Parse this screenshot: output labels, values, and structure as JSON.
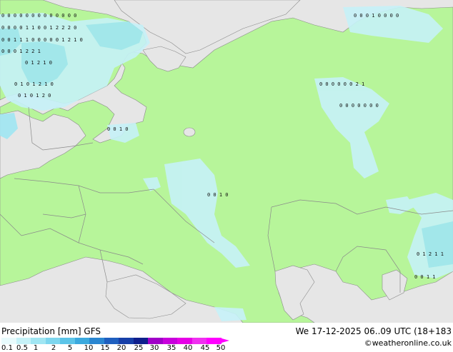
{
  "title": "Precipitation [mm]",
  "model": "GFS",
  "valid": "We 17-12-2025 06..09 UTC (18+183",
  "credit": "©weatheronline.co.uk",
  "legend": {
    "ticks": [
      "0.1",
      "0.5",
      "1",
      "2",
      "5",
      "10",
      "15",
      "20",
      "25",
      "30",
      "35",
      "40",
      "45",
      "50"
    ],
    "colors": [
      "#e8fbfd",
      "#c6f2f8",
      "#a0e6f3",
      "#7dd6ee",
      "#5cc4e8",
      "#3ba9de",
      "#2a86d1",
      "#1f5fbf",
      "#173fa8",
      "#0f1f8c",
      "#a000c8",
      "#c800dc",
      "#e600e6",
      "#f030f0",
      "#ff00ff"
    ]
  },
  "colors": {
    "land": "#b7f59a",
    "sea": "#e6e6e6",
    "precip_light": "#c6f2f8",
    "precip_mid": "#a0e6f3",
    "border": "#8a8a8a"
  },
  "grid_values": [
    {
      "row": "r1",
      "text": "0 0 0 0 0 0 0 0 0 0 0 0 0"
    },
    {
      "row": "r2",
      "text": "0 0 0 0 1 1 0 0 1 2 2 2 0"
    },
    {
      "row": "r3",
      "text": "0 0 1 1 1 0 0 0 0 0 1 2 1 0"
    },
    {
      "row": "r4",
      "text": "0 0 0 1 2 2 1"
    },
    {
      "row": "r5",
      "text": "0 1 2 1 0"
    },
    {
      "row": "r6",
      "text": "0 1 0 1 2 1 0"
    },
    {
      "row": "r7",
      "text": "0 1 0 1 2 0"
    },
    {
      "row": "r8",
      "text": "0 0 1 0"
    },
    {
      "row": "r9",
      "text": "0 0 0 1 0 0 0 0"
    },
    {
      "row": "r10",
      "text": "0 0 0 0 0 0 2 1"
    },
    {
      "row": "r11",
      "text": "0 0 0 0 0 0 0"
    },
    {
      "row": "r12",
      "text": "0 1 2 1 1"
    },
    {
      "row": "r13",
      "text": "0 0 1 1"
    },
    {
      "row": "r14",
      "text": "0 0 1 0"
    }
  ]
}
